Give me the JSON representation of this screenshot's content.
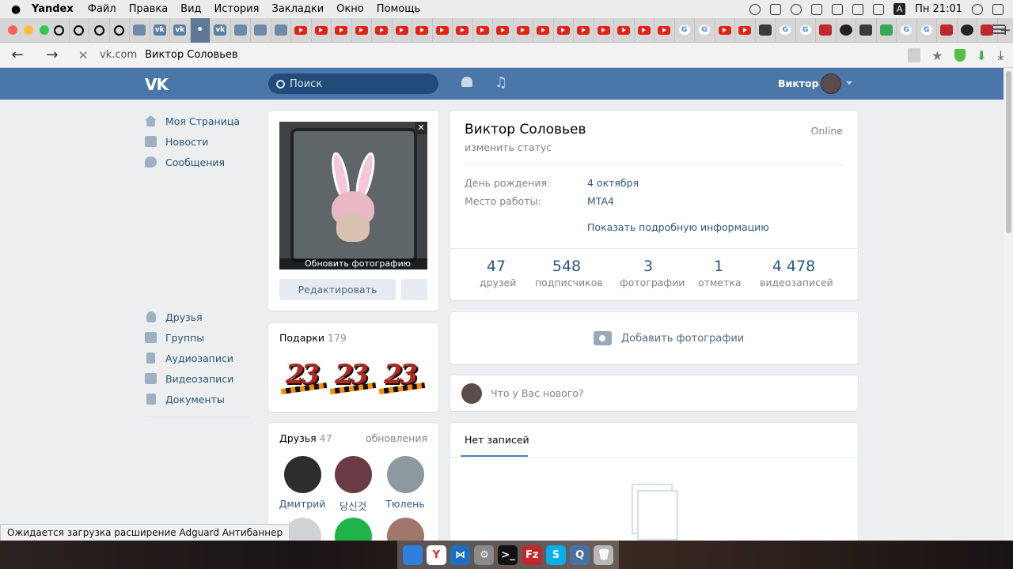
{
  "menubar": {
    "app_name": "Yandex",
    "items": [
      "Файл",
      "Правка",
      "Вид",
      "История",
      "Закладки",
      "Окно",
      "Помощь"
    ],
    "time": "Пн 21:01",
    "input_indicator": "A"
  },
  "tabstrip": {
    "favicons": [
      "wheel",
      "wheel",
      "wheel",
      "wheel",
      "gray",
      "vk",
      "vk",
      "dot",
      "vk",
      "gray",
      "gray",
      "gray",
      "yt",
      "yt",
      "yt",
      "yt",
      "yt",
      "yt",
      "yt",
      "yt",
      "yt",
      "yt",
      "yt",
      "yt",
      "yt",
      "yt",
      "yt",
      "yt",
      "yt",
      "yt",
      "yt",
      "g",
      "g",
      "yt",
      "yt",
      "mixed",
      "g",
      "g",
      "red2",
      "dark",
      "mixed",
      "green",
      "g",
      "g",
      "red2",
      "dark",
      "red2"
    ],
    "active_index": 7,
    "new_tab_label": "+"
  },
  "addressbar": {
    "host": "vk.com",
    "title": "Виктор Соловьев"
  },
  "vk_header": {
    "logo": "VK",
    "search_placeholder": "Поиск",
    "user_name": "Виктор"
  },
  "left_nav": {
    "top_items": [
      {
        "label": "Моя Страница",
        "icon": "home-icon"
      },
      {
        "label": "Новости",
        "icon": "news-icon"
      },
      {
        "label": "Сообщения",
        "icon": "messages-icon"
      }
    ],
    "bottom_items": [
      {
        "label": "Друзья",
        "icon": "friends-icon"
      },
      {
        "label": "Группы",
        "icon": "groups-icon"
      },
      {
        "label": "Аудиозаписи",
        "icon": "audio-icon"
      },
      {
        "label": "Видеозаписи",
        "icon": "video-icon"
      },
      {
        "label": "Документы",
        "icon": "documents-icon"
      }
    ]
  },
  "photo_card": {
    "update_photo_label": "Обновить фотографию",
    "edit_label": "Редактировать",
    "close_label": "✕"
  },
  "gifts": {
    "title": "Подарки",
    "count": "179",
    "items": [
      "23",
      "23",
      "23"
    ]
  },
  "friends": {
    "title": "Друзья",
    "count": "47",
    "updates_label": "обновления",
    "items": [
      {
        "name": "Дмитрий",
        "color": "#2d2d2d"
      },
      {
        "name": "당신것",
        "color": "#6a3b45"
      },
      {
        "name": "Тюлень",
        "color": "#8c9aa0"
      }
    ],
    "second_row_colors": [
      "#cfd3d6",
      "#1fb34a",
      "#a2776b"
    ]
  },
  "profile": {
    "name": "Виктор Соловьев",
    "status_link": "изменить статус",
    "online": "Online",
    "fields": [
      {
        "label": "День рождения:",
        "value": "4 октября"
      },
      {
        "label": "Место работы:",
        "value": "MTA4"
      }
    ],
    "show_more": "Показать подробную информацию",
    "counters": [
      {
        "num": "47",
        "label": "друзей"
      },
      {
        "num": "548",
        "label": "подписчиков"
      },
      {
        "num": "3",
        "label": "фотографии"
      },
      {
        "num": "1",
        "label": "отметка"
      },
      {
        "num": "4 478",
        "label": "видеозаписей"
      }
    ]
  },
  "add_photo": {
    "label": "Добавить фотографии"
  },
  "post_box": {
    "placeholder": "Что у Вас нового?"
  },
  "wall": {
    "tab": "Нет записей"
  },
  "status_tip": "Ожидается загрузка расширение Adguard Антибаннер",
  "dock": {
    "apps": [
      {
        "name": "finder-icon",
        "color": "#2f7fe0",
        "glyph": ""
      },
      {
        "name": "yandex-browser-icon",
        "color": "#ffffff",
        "glyph": "Y"
      },
      {
        "name": "vscode-icon",
        "color": "#1e6fbf",
        "glyph": "⋈"
      },
      {
        "name": "system-preferences-icon",
        "color": "#8a8a8a",
        "glyph": "⚙"
      },
      {
        "name": "terminal-icon",
        "color": "#111111",
        "glyph": ">_"
      },
      {
        "name": "filezilla-icon",
        "color": "#c1272d",
        "glyph": "Fz"
      },
      {
        "name": "skype-icon",
        "color": "#00aff0",
        "glyph": "S"
      },
      {
        "name": "quicktime-icon",
        "color": "#4a6fa5",
        "glyph": "Q"
      },
      {
        "name": "trash-icon",
        "color": "#b8b8b8",
        "glyph": "🗑"
      }
    ]
  },
  "colors": {
    "vk_blue": "#4a76a8",
    "link": "#2a5885",
    "page_bg": "#edeef0"
  }
}
